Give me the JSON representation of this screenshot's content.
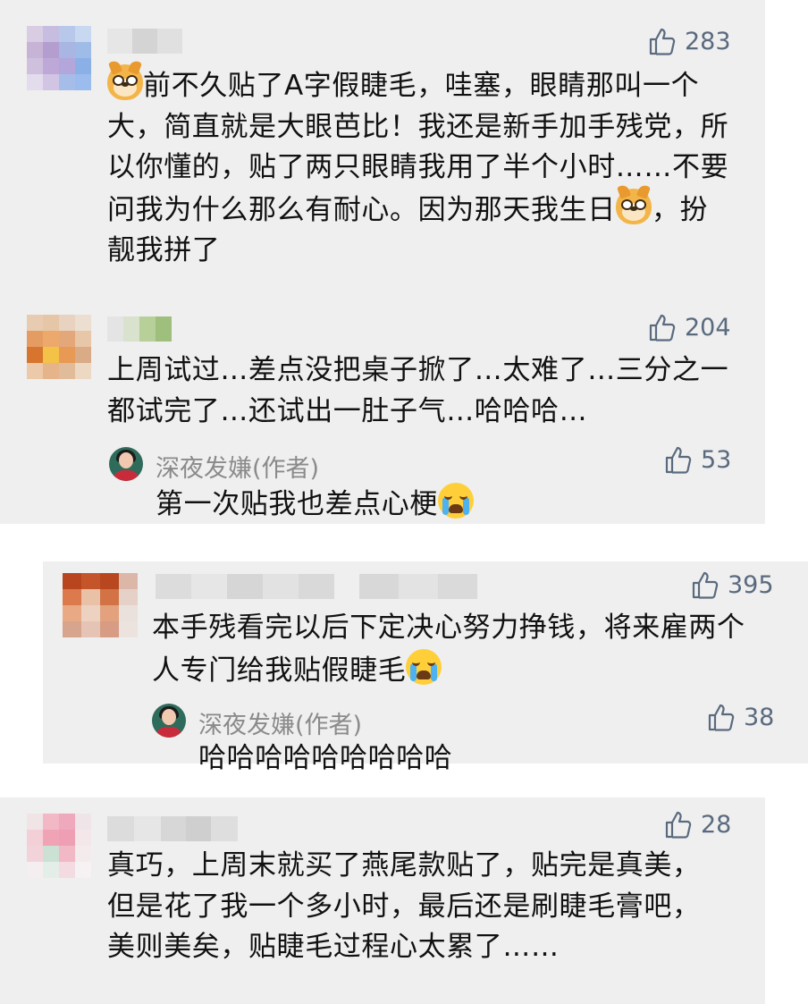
{
  "colors": {
    "card_bg": "#efefef",
    "like_color": "#5a6a7e",
    "reply_name_color": "#8a8a8a",
    "text_color": "#111111"
  },
  "icons": {
    "like": "thumbs-up-icon",
    "emoji_dog": "doge-emoji-icon",
    "emoji_cry": "crying-face-emoji-icon"
  },
  "comments": [
    {
      "likes": "283",
      "text_parts": [
        "前不久贴了A字假睫毛，哇塞，眼睛那叫一个大，简直就是大眼芭比！我还是新手加手残党，所以你懂的，贴了两只眼睛我用了半个小时……不要问我为什么那么有耐心。因为那天我生日",
        "，扮靓我拼了"
      ],
      "reply": null
    },
    {
      "likes": "204",
      "text": "上周试过…差点没把桌子掀了…太难了…三分之一都试完了…还试出一肚子气…哈哈哈…",
      "reply": {
        "author": "深夜发嫌(作者)",
        "likes": "53",
        "text": "第一次贴我也差点心梗"
      }
    },
    {
      "likes": "395",
      "text": "本手残看完以后下定决心努力挣钱，将来雇两个人专门给我贴假睫毛",
      "reply": {
        "author": "深夜发嫌(作者)",
        "likes": "38",
        "text": "哈哈哈哈哈哈哈哈哈"
      }
    },
    {
      "likes": "28",
      "text": "真巧，上周末就买了燕尾款贴了，贴完是真美，但是花了我一个多小时，最后还是刷睫毛膏吧，美则美矣，贴睫毛过程心太累了……",
      "reply": null
    }
  ]
}
